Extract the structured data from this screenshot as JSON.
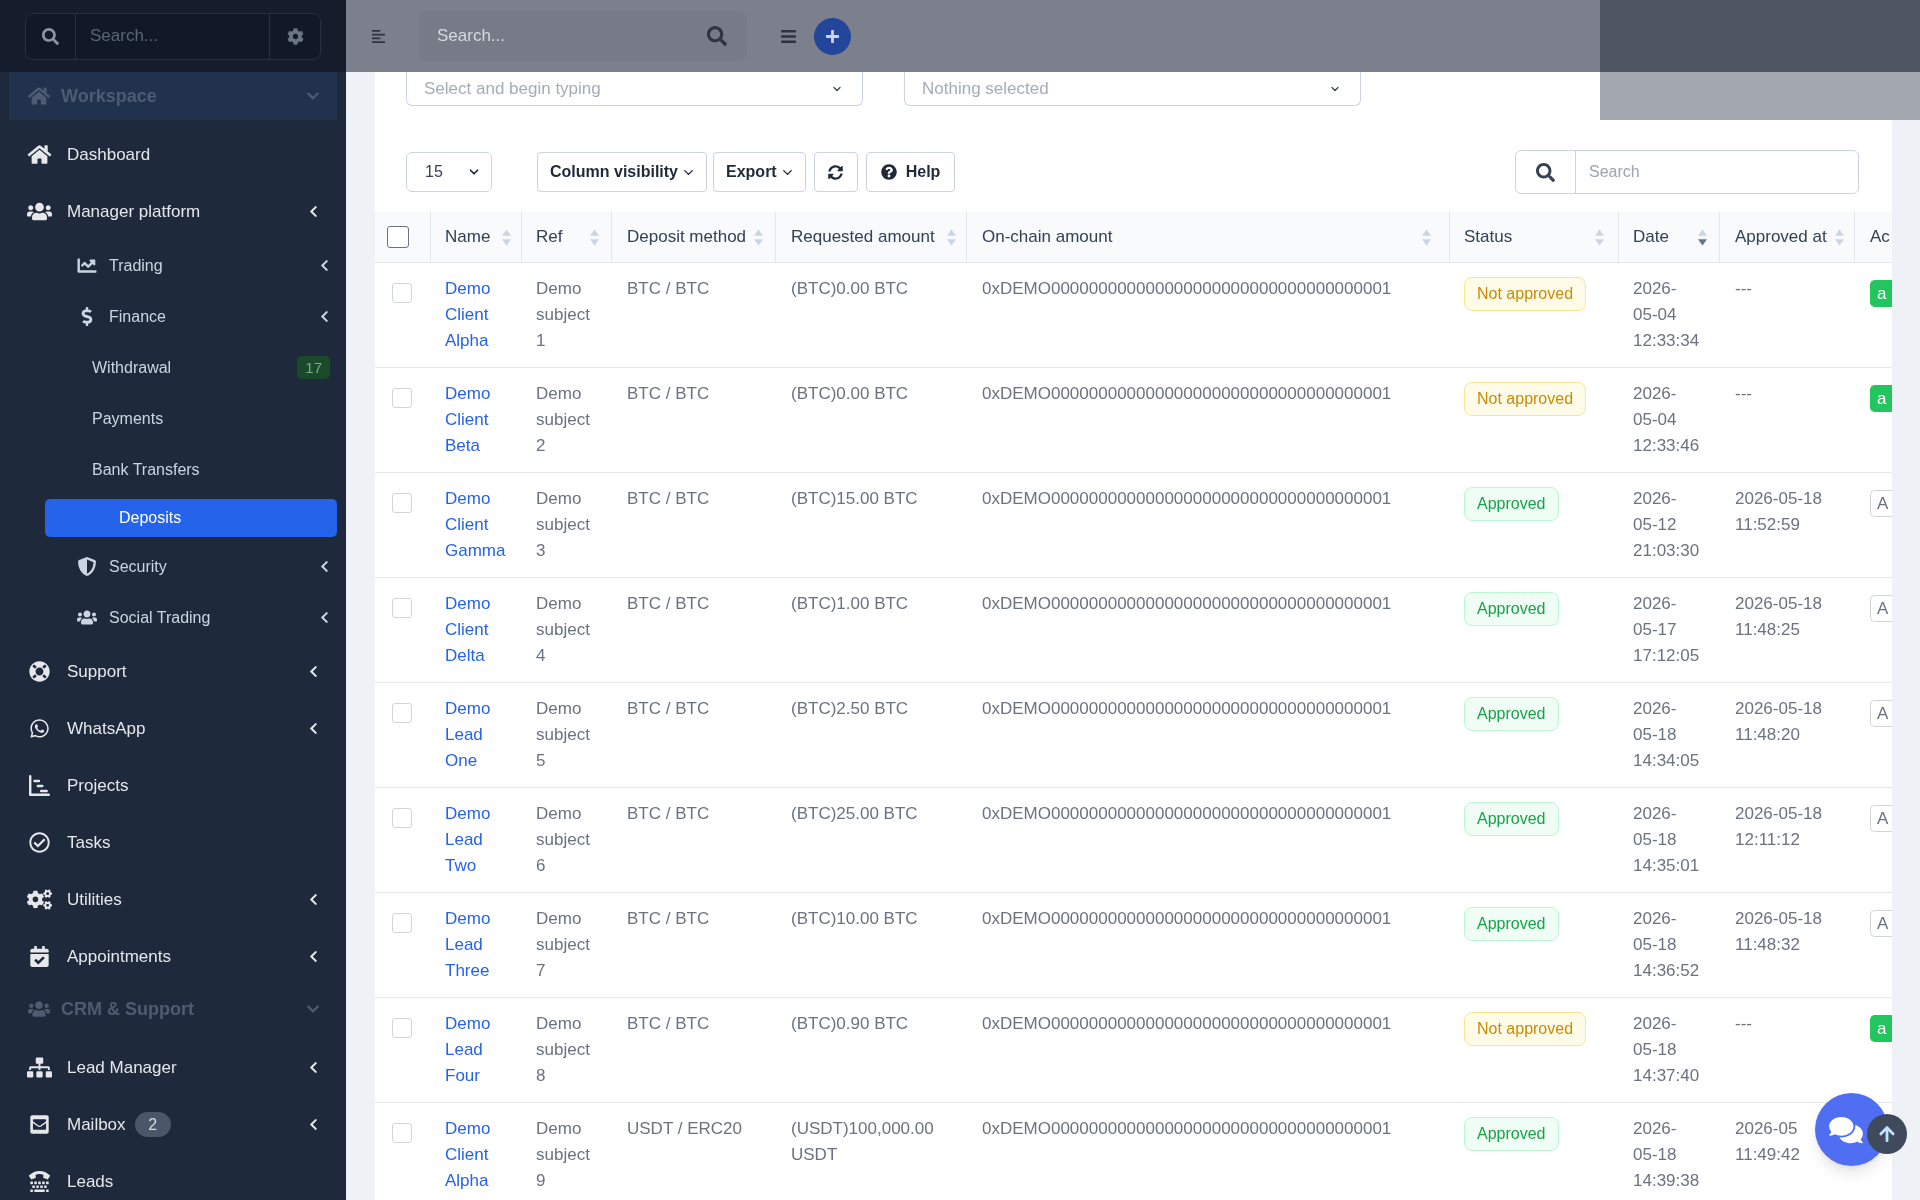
{
  "sidebar": {
    "search": {
      "placeholder": "Search..."
    },
    "items": [
      {
        "kind": "section",
        "label": "Workspace",
        "highlighted": true,
        "expanded": true
      },
      {
        "kind": "link",
        "label": "Dashboard",
        "selected": false
      },
      {
        "kind": "link",
        "label": "Manager platform",
        "selected": false,
        "has_submenu": true,
        "children": [
          {
            "kind": "link",
            "label": "Trading",
            "selected": false,
            "has_submenu": true
          },
          {
            "kind": "link",
            "label": "Finance",
            "selected": false,
            "has_submenu": true,
            "children": [
              {
                "kind": "link",
                "label": "Withdrawal",
                "selected": false,
                "badge": {
                  "text": "17",
                  "kind": "success"
                }
              },
              {
                "kind": "link",
                "label": "Payments",
                "selected": false
              },
              {
                "kind": "link",
                "label": "Bank Transfers",
                "selected": false
              },
              {
                "kind": "link",
                "label": "Deposits",
                "selected": true
              }
            ]
          },
          {
            "kind": "link",
            "label": "Security",
            "selected": false,
            "has_submenu": true
          },
          {
            "kind": "link",
            "label": "Social Trading",
            "selected": false,
            "has_submenu": true
          }
        ]
      },
      {
        "kind": "link",
        "label": "Support",
        "selected": false,
        "has_submenu": true
      },
      {
        "kind": "link",
        "label": "WhatsApp",
        "selected": false,
        "has_submenu": true
      },
      {
        "kind": "link",
        "label": "Projects",
        "selected": false
      },
      {
        "kind": "link",
        "label": "Tasks",
        "selected": false
      },
      {
        "kind": "link",
        "label": "Utilities",
        "selected": false,
        "has_submenu": true
      },
      {
        "kind": "link",
        "label": "Appointments",
        "selected": false,
        "has_submenu": true
      },
      {
        "kind": "section",
        "label": "CRM & Support",
        "highlighted": false,
        "expanded": true
      },
      {
        "kind": "link",
        "label": "Lead Manager",
        "selected": false,
        "has_submenu": true
      },
      {
        "kind": "link",
        "label": "Mailbox",
        "selected": false,
        "has_submenu": true,
        "badge": {
          "text": "2",
          "kind": "neutral"
        }
      },
      {
        "kind": "link",
        "label": "Leads",
        "selected": false
      }
    ]
  },
  "header": {
    "search": {
      "placeholder": "Search..."
    }
  },
  "filters": [
    {
      "placeholder": "Select and begin typing"
    },
    {
      "placeholder": "Nothing selected"
    }
  ],
  "toolbar": {
    "page_length": {
      "value": "15"
    },
    "buttons": [
      {
        "kind": "dropdown",
        "label": "Column visibility"
      },
      {
        "kind": "dropdown",
        "label": "Export"
      },
      {
        "kind": "refresh"
      },
      {
        "kind": "help",
        "label": "Help"
      }
    ],
    "search": {
      "placeholder": "Search"
    }
  },
  "table": {
    "select_all": {
      "checked": false
    },
    "columns": [
      {
        "label": "Name",
        "sorted": false
      },
      {
        "label": "Ref",
        "sorted": false
      },
      {
        "label": "Deposit method",
        "sorted": false
      },
      {
        "label": "Requested amount",
        "sorted": false
      },
      {
        "label": "On-chain amount",
        "sorted": false
      },
      {
        "label": "Status",
        "sorted": false
      },
      {
        "label": "Date",
        "sorted": true
      },
      {
        "label": "Approved at",
        "sorted": false
      },
      {
        "label": "Ac"
      }
    ],
    "rows": [
      {
        "checked": false,
        "name": "Demo Client Alpha",
        "ref": "Demo subject 1",
        "deposit_method": "BTC / BTC",
        "requested_amount": "(BTC)0.00 BTC",
        "onchain_amount": "0xDEMO000000000000000000000000000000000001",
        "status": {
          "label": "Not approved",
          "kind": "not_approved"
        },
        "date": "2026-05-04 12:33:34",
        "approved_at": "---",
        "action": {
          "label": "a",
          "kind": "filled"
        }
      },
      {
        "checked": false,
        "name": "Demo Client Beta",
        "ref": "Demo subject 2",
        "deposit_method": "BTC / BTC",
        "requested_amount": "(BTC)0.00 BTC",
        "onchain_amount": "0xDEMO000000000000000000000000000000000001",
        "status": {
          "label": "Not approved",
          "kind": "not_approved"
        },
        "date": "2026-05-04 12:33:46",
        "approved_at": "---",
        "action": {
          "label": "a",
          "kind": "filled"
        }
      },
      {
        "checked": false,
        "name": "Demo Client Gamma",
        "ref": "Demo subject 3",
        "deposit_method": "BTC / BTC",
        "requested_amount": "(BTC)15.00 BTC",
        "onchain_amount": "0xDEMO000000000000000000000000000000000001",
        "status": {
          "label": "Approved",
          "kind": "approved"
        },
        "date": "2026-05-12 21:03:30",
        "approved_at": "2026-05-18 11:52:59",
        "action": {
          "label": "A",
          "kind": "outline"
        }
      },
      {
        "checked": false,
        "name": "Demo Client Delta",
        "ref": "Demo subject 4",
        "deposit_method": "BTC / BTC",
        "requested_amount": "(BTC)1.00 BTC",
        "onchain_amount": "0xDEMO000000000000000000000000000000000001",
        "status": {
          "label": "Approved",
          "kind": "approved"
        },
        "date": "2026-05-17 17:12:05",
        "approved_at": "2026-05-18 11:48:25",
        "action": {
          "label": "A",
          "kind": "outline"
        }
      },
      {
        "checked": false,
        "name": "Demo Lead One",
        "ref": "Demo subject 5",
        "deposit_method": "BTC / BTC",
        "requested_amount": "(BTC)2.50 BTC",
        "onchain_amount": "0xDEMO000000000000000000000000000000000001",
        "status": {
          "label": "Approved",
          "kind": "approved"
        },
        "date": "2026-05-18 14:34:05",
        "approved_at": "2026-05-18 11:48:20",
        "action": {
          "label": "A",
          "kind": "outline"
        }
      },
      {
        "checked": false,
        "name": "Demo Lead Two",
        "ref": "Demo subject 6",
        "deposit_method": "BTC / BTC",
        "requested_amount": "(BTC)25.00 BTC",
        "onchain_amount": "0xDEMO000000000000000000000000000000000001",
        "status": {
          "label": "Approved",
          "kind": "approved"
        },
        "date": "2026-05-18 14:35:01",
        "approved_at": "2026-05-18 12:11:12",
        "action": {
          "label": "A",
          "kind": "outline"
        }
      },
      {
        "checked": false,
        "name": "Demo Lead Three",
        "ref": "Demo subject 7",
        "deposit_method": "BTC / BTC",
        "requested_amount": "(BTC)10.00 BTC",
        "onchain_amount": "0xDEMO000000000000000000000000000000000001",
        "status": {
          "label": "Approved",
          "kind": "approved"
        },
        "date": "2026-05-18 14:36:52",
        "approved_at": "2026-05-18 11:48:32",
        "action": {
          "label": "A",
          "kind": "outline"
        }
      },
      {
        "checked": false,
        "name": "Demo Lead Four",
        "ref": "Demo subject 8",
        "deposit_method": "BTC / BTC",
        "requested_amount": "(BTC)0.90 BTC",
        "onchain_amount": "0xDEMO000000000000000000000000000000000001",
        "status": {
          "label": "Not approved",
          "kind": "not_approved"
        },
        "date": "2026-05-18 14:37:40",
        "approved_at": "---",
        "action": {
          "label": "a",
          "kind": "filled"
        }
      },
      {
        "checked": false,
        "name": "Demo Client Alpha",
        "ref": "Demo subject 9",
        "deposit_method": "USDT / ERC20",
        "requested_amount": "(USDT)100,000.00 USDT",
        "onchain_amount": "0xDEMO000000000000000000000000000000000001",
        "status": {
          "label": "Approved",
          "kind": "approved"
        },
        "date": "2026-05-18 14:39:38",
        "approved_at": "2026-05 11:49:42"
      }
    ]
  }
}
